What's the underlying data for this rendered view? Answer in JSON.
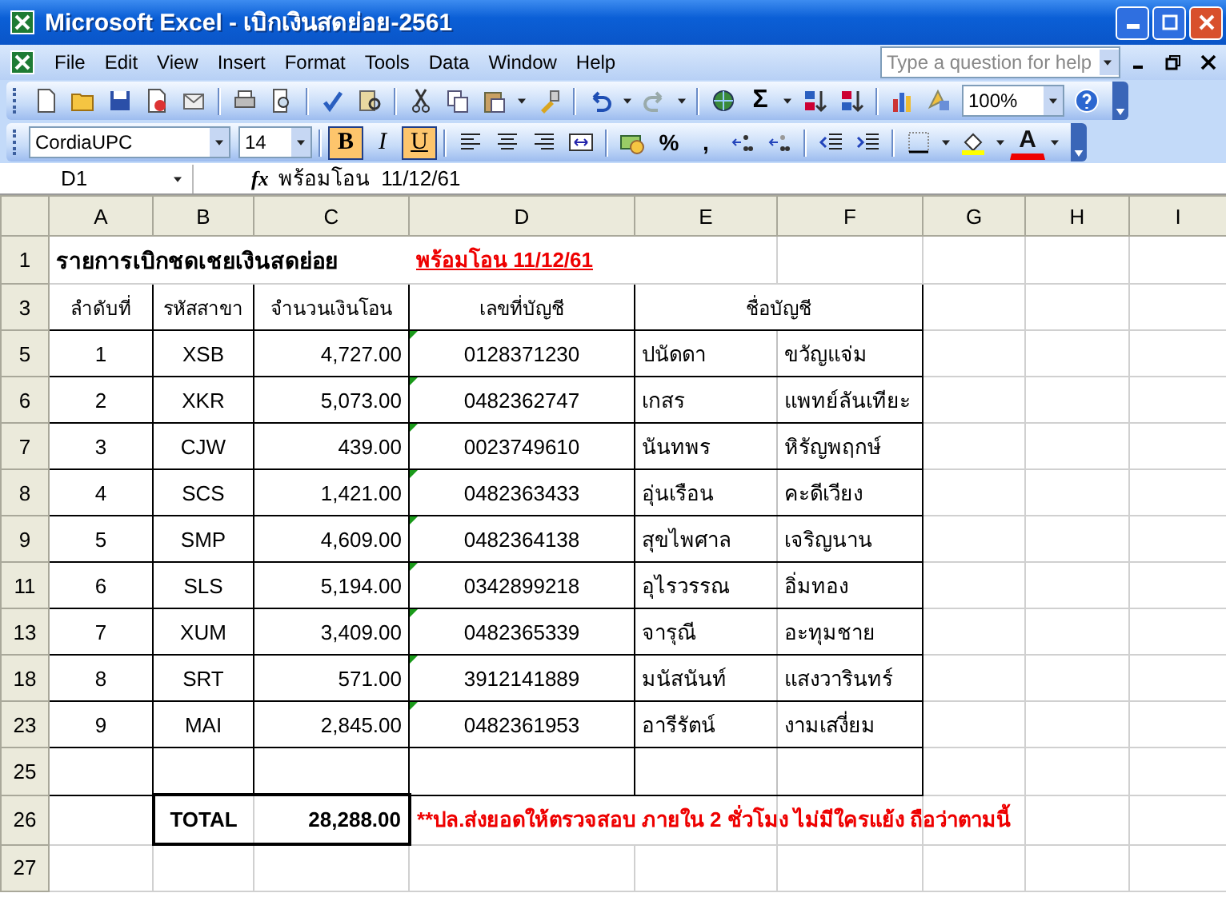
{
  "window": {
    "title": "Microsoft Excel - เบิกเงินสดย่อย-2561"
  },
  "menu": [
    {
      "label": "File"
    },
    {
      "label": "Edit"
    },
    {
      "label": "View"
    },
    {
      "label": "Insert"
    },
    {
      "label": "Format"
    },
    {
      "label": "Tools"
    },
    {
      "label": "Data"
    },
    {
      "label": "Window"
    },
    {
      "label": "Help"
    }
  ],
  "help_box": {
    "placeholder": "Type a question for help"
  },
  "toolbar": {
    "sum": "Σ",
    "zoom": "100%"
  },
  "format_bar": {
    "font": "CordiaUPC",
    "size": "14",
    "styles": [
      {
        "label": "B",
        "selected": true
      },
      {
        "label": "I",
        "selected": false
      },
      {
        "label": "U",
        "selected": true
      }
    ],
    "percent": "%",
    "comma": ",",
    "font_color": "A"
  },
  "formula_bar": {
    "name_box": "D1",
    "fx": "fx",
    "formula": "พร้อมโอน  11/12/61"
  },
  "columns": [
    "A",
    "B",
    "C",
    "D",
    "E",
    "F",
    "G",
    "H",
    "I"
  ],
  "title_row": {
    "num": "1",
    "title": "รายการเบิกชดเชยเงินสดย่อย",
    "note": "พร้อมโอน  11/12/61"
  },
  "header_row": {
    "num": "3",
    "headers": [
      "ลำดับที่",
      "รหัสสาขา",
      "จำนวนเงินโอน",
      "เลขที่บัญชี",
      "ชื่อบัญชี"
    ]
  },
  "rows": [
    {
      "num": "5",
      "no": "1",
      "branch": "XSB",
      "amount": "4,727.00",
      "account": "0128371230",
      "first_name": "ปนัดดา",
      "last_name": "ขวัญแจ่ม"
    },
    {
      "num": "6",
      "no": "2",
      "branch": "XKR",
      "amount": "5,073.00",
      "account": "0482362747",
      "first_name": "เกสร",
      "last_name": "แพทย์ลันเทียะ"
    },
    {
      "num": "7",
      "no": "3",
      "branch": "CJW",
      "amount": "439.00",
      "account": "0023749610",
      "first_name": "นันทพร",
      "last_name": "หิรัญพฤกษ์"
    },
    {
      "num": "8",
      "no": "4",
      "branch": "SCS",
      "amount": "1,421.00",
      "account": "0482363433",
      "first_name": "อุ่นเรือน",
      "last_name": "คะดีเวียง"
    },
    {
      "num": "9",
      "no": "5",
      "branch": "SMP",
      "amount": "4,609.00",
      "account": "0482364138",
      "first_name": "สุขไพศาล",
      "last_name": "เจริญนาน"
    },
    {
      "num": "11",
      "no": "6",
      "branch": "SLS",
      "amount": "5,194.00",
      "account": "0342899218",
      "first_name": "อุไรวรรณ",
      "last_name": "อิ่มทอง"
    },
    {
      "num": "13",
      "no": "7",
      "branch": "XUM",
      "amount": "3,409.00",
      "account": "0482365339",
      "first_name": "จารุณี",
      "last_name": "อะทุมชาย"
    },
    {
      "num": "18",
      "no": "8",
      "branch": "SRT",
      "amount": "571.00",
      "account": "3912141889",
      "first_name": "มนัสนันท์",
      "last_name": "แสงวารินทร์"
    },
    {
      "num": "23",
      "no": "9",
      "branch": "MAI",
      "amount": "2,845.00",
      "account": "0482361953",
      "first_name": "อารีรัตน์",
      "last_name": "งามเสงี่ยม"
    }
  ],
  "blank_row": {
    "num": "25"
  },
  "total_row": {
    "num": "26",
    "label": "TOTAL",
    "amount": "28,288.00",
    "note": "**ปล.ส่งยอดให้ตรวจสอบ ภายใน 2 ชั่วโมง ไม่มีใครแย้ง ถือว่าตามนี้"
  },
  "extra_rows": [
    {
      "num": "27"
    }
  ]
}
